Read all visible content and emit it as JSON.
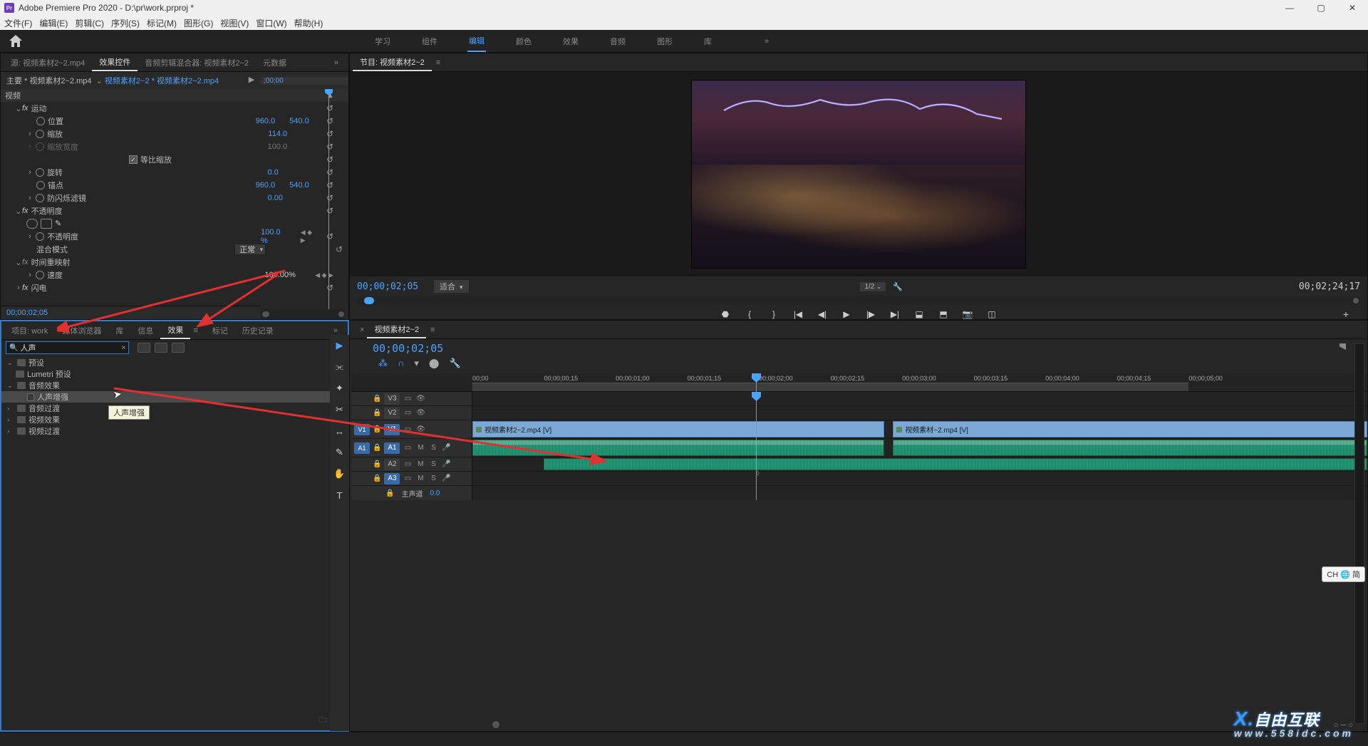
{
  "app": {
    "title": "Adobe Premiere Pro 2020 - D:\\pr\\work.prproj *",
    "menu": [
      "文件(F)",
      "编辑(E)",
      "剪辑(C)",
      "序列(S)",
      "标记(M)",
      "图形(G)",
      "视图(V)",
      "窗口(W)",
      "帮助(H)"
    ],
    "workspaces": [
      "学习",
      "组件",
      "编辑",
      "颜色",
      "效果",
      "音频",
      "图形",
      "库"
    ],
    "workspace_active": "编辑"
  },
  "source_tabs": [
    "源: 视频素材2~2.mp4",
    "效果控件",
    "音频剪辑混合器: 视频素材2~2",
    "元数据"
  ],
  "source_active": "效果控件",
  "effect_controls": {
    "master": "主要 * 视频素材2~2.mp4",
    "clip": "视频素材2~2 * 视频素材2~2.mp4",
    "tc_col": ";00;00",
    "clipname": "视频素材2~2.mp4",
    "section_video": "视频",
    "rows": [
      {
        "label": "运动",
        "type": "fx"
      },
      {
        "label": "位置",
        "v1": "960.0",
        "v2": "540.0"
      },
      {
        "label": "缩放",
        "v1": "114.0"
      },
      {
        "label": "缩放宽度",
        "v1": "100.0",
        "gray": true
      },
      {
        "label": "等比缩放",
        "checkbox": true
      },
      {
        "label": "旋转",
        "v1": "0.0"
      },
      {
        "label": "锚点",
        "v1": "960.0",
        "v2": "540.0"
      },
      {
        "label": "防闪烁滤镜",
        "v1": "0.00"
      }
    ],
    "opacity": {
      "title": "不透明度",
      "value": "100.0 %",
      "mode_label": "混合模式",
      "mode": "正常"
    },
    "time_remap": {
      "title": "时间重映射",
      "speed": "速度",
      "value": "100.00%"
    },
    "lightning": "闪电",
    "tc_bottom": "00;00;02;05"
  },
  "program": {
    "tab": "节目: 视频素材2~2",
    "tc_left": "00;00;02;05",
    "fit": "适合",
    "zoom": "1/2",
    "tc_right": "00;02;24;17"
  },
  "project_tabs": [
    "项目: work",
    "媒体浏览器",
    "库",
    "信息",
    "效果",
    "标记",
    "历史记录"
  ],
  "project_active": "效果",
  "effects_panel": {
    "search": "人声",
    "tree": [
      {
        "label": "预设",
        "type": "folder",
        "open": true,
        "depth": 0
      },
      {
        "label": "Lumetri 预设",
        "type": "folder",
        "open": false,
        "depth": 0
      },
      {
        "label": "音频效果",
        "type": "folder",
        "open": true,
        "depth": 0
      },
      {
        "label": "人声增强",
        "type": "file",
        "depth": 1,
        "sel": true
      },
      {
        "label": "音频过渡",
        "type": "folder",
        "open": false,
        "depth": 0
      },
      {
        "label": "视频效果",
        "type": "folder",
        "open": false,
        "depth": 0
      },
      {
        "label": "视频过渡",
        "type": "folder",
        "open": false,
        "depth": 0
      }
    ],
    "tooltip": "人声增强"
  },
  "timeline": {
    "tab": "视频素材2~2",
    "tc": "00;00;02;05",
    "ruler": [
      "00;00",
      "00;00;00;15",
      "00;00;01;00",
      "00;00;01;15",
      "00;00;02;00",
      "00;00;02;15",
      "00;00;03;00",
      "00;00;03;15",
      "00;00;04;00",
      "00;00;04;15",
      "00;00;05;00"
    ],
    "tracks_v": [
      "V3",
      "V2",
      "V1"
    ],
    "tracks_a": [
      "A1",
      "A2",
      "A3"
    ],
    "src_v": "V1",
    "src_a": "A1",
    "master": "主声道",
    "master_val": "0.0",
    "clip1": "视频素材2~2.mp4 [V]",
    "clip2": "视频素材~2.mp4 [V]"
  },
  "watermark": {
    "brand": "自由互联",
    "url": "www.558idc.com"
  },
  "ime": "CH 🌐 简"
}
